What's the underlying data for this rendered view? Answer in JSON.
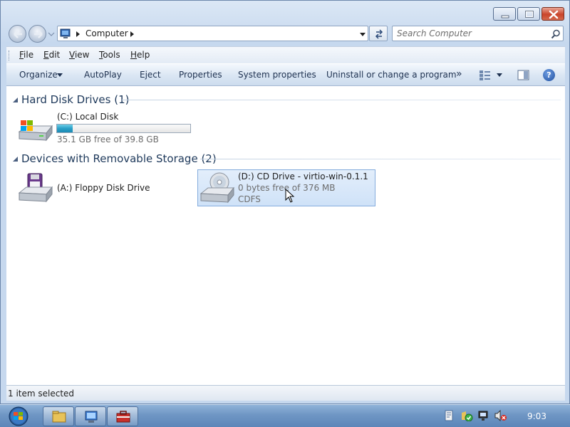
{
  "window": {
    "caption_buttons": [
      "minimize",
      "maximize",
      "close"
    ]
  },
  "navigation": {
    "breadcrumb": "Computer",
    "search_placeholder": "Search Computer"
  },
  "menu": {
    "items": [
      {
        "label": "File",
        "accel": "F",
        "rest": "ile"
      },
      {
        "label": "Edit",
        "accel": "E",
        "rest": "dit"
      },
      {
        "label": "View",
        "accel": "V",
        "rest": "iew"
      },
      {
        "label": "Tools",
        "accel": "T",
        "rest": "ools"
      },
      {
        "label": "Help",
        "accel": "H",
        "rest": "elp"
      }
    ]
  },
  "commands": {
    "organize": "Organize",
    "autoplay": "AutoPlay",
    "eject": "Eject",
    "properties": "Properties",
    "system_properties": "System properties",
    "uninstall": "Uninstall or change a program",
    "more": "»",
    "help": "?"
  },
  "groups": {
    "hard_disks": {
      "title": "Hard Disk Drives (1)",
      "drives": [
        {
          "name": "(C:) Local Disk",
          "free_text": "35.1 GB free of 39.8 GB",
          "used_fraction": 0.118
        }
      ]
    },
    "removable": {
      "title": "Devices with Removable Storage (2)",
      "drives": [
        {
          "name": "(A:) Floppy Disk Drive"
        },
        {
          "name": "(D:) CD Drive - virtio-win-0.1.1",
          "free_text": "0 bytes free of 376 MB",
          "filesystem": "CDFS",
          "selected": true
        }
      ]
    }
  },
  "status": {
    "text": "1 item selected"
  },
  "taskbar": {
    "clock": "9:03",
    "pinned": [
      "explorer-icon",
      "network-app-icon",
      "toolbox-icon"
    ],
    "tray": [
      "flag-icon",
      "action-center-icon",
      "network-icon",
      "volume-muted-icon"
    ]
  },
  "colors": {
    "accent": "#1e395b",
    "selection": "#cfe2f8",
    "usage_fill": "#2aa0c8",
    "close_button": "#c9442a"
  }
}
